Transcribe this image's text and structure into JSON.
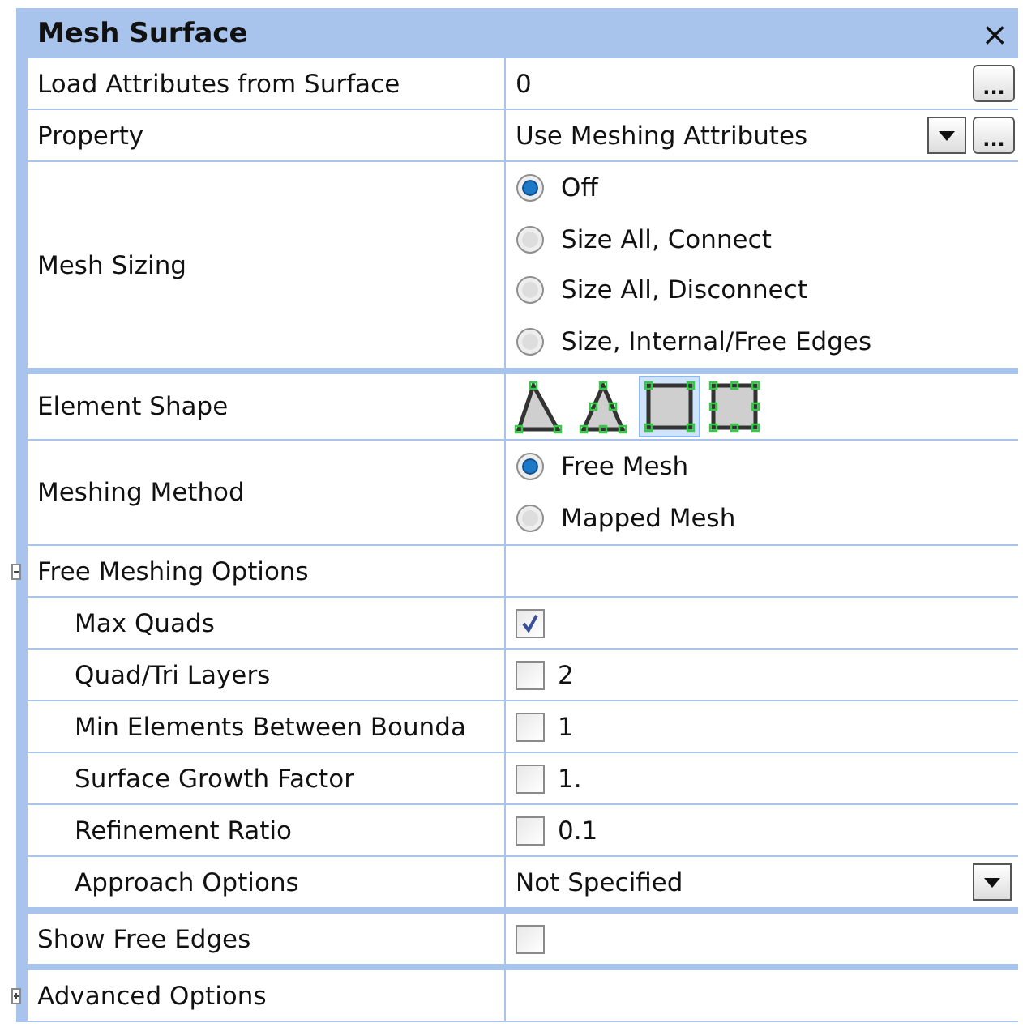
{
  "panel": {
    "title": "Mesh Surface",
    "close": "×"
  },
  "sections": [
    {
      "rows": [
        {
          "kind": "button",
          "label": "Load Attributes from Surface",
          "value": "0",
          "button": "..."
        },
        {
          "kind": "combo",
          "label": "Property",
          "value": "Use Meshing Attributes",
          "button": "..."
        },
        {
          "kind": "radio",
          "label": "Mesh Sizing",
          "options": [
            {
              "label": "Off",
              "selected": true
            },
            {
              "label": "Size All, Connect",
              "selected": false
            },
            {
              "label": "Size All, Disconnect",
              "selected": false
            },
            {
              "label": "Size, Internal/Free Edges",
              "selected": false
            }
          ]
        }
      ]
    },
    {
      "rows": [
        {
          "kind": "shapes",
          "label": "Element Shape",
          "shapes": [
            {
              "kind": "tri3",
              "selected": false
            },
            {
              "kind": "tri6",
              "selected": false
            },
            {
              "kind": "quad4",
              "selected": true
            },
            {
              "kind": "quad8",
              "selected": false
            }
          ]
        },
        {
          "kind": "radio",
          "label": "Meshing Method",
          "options": [
            {
              "label": "Free Mesh",
              "selected": true
            },
            {
              "label": "Mapped Mesh",
              "selected": false
            }
          ]
        },
        {
          "kind": "group",
          "label": "Free Meshing Options",
          "expanded": true,
          "children": [
            {
              "kind": "check",
              "label": "Max Quads",
              "checked": true
            },
            {
              "kind": "check",
              "label": "Quad/Tri Layers",
              "checked": false,
              "value": "2"
            },
            {
              "kind": "check",
              "label": "Min Elements Between Bounda",
              "checked": false,
              "value": "1"
            },
            {
              "kind": "check",
              "label": "Surface Growth Factor",
              "checked": false,
              "value": "1."
            },
            {
              "kind": "check",
              "label": "Refinement Ratio",
              "checked": false,
              "value": "0.1"
            },
            {
              "kind": "dropdown",
              "label": "Approach Options",
              "value": "Not Specified"
            }
          ]
        }
      ]
    },
    {
      "rows": [
        {
          "kind": "check",
          "label": "Show Free Edges",
          "checked": false
        }
      ]
    },
    {
      "rows": [
        {
          "kind": "group",
          "label": "Advanced Options",
          "expanded": false,
          "children": []
        }
      ]
    }
  ]
}
